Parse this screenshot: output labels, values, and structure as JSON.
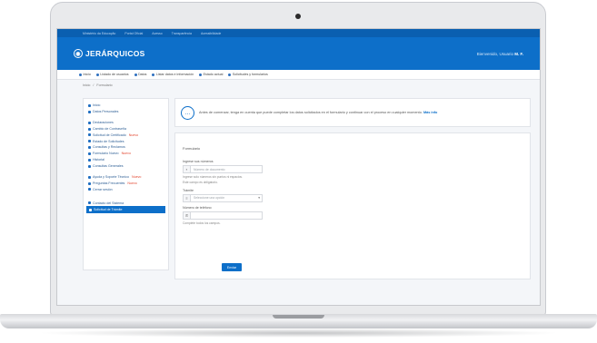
{
  "topstrip": {
    "items": [
      "Ministério da Educação",
      "Portal Oficial",
      "Acesso",
      "Transparência",
      "Acessibilidade"
    ]
  },
  "header": {
    "logo_text": "JERÁRQUICOS",
    "user_text": "Bienvenido, Usuario",
    "user_name": "M. F."
  },
  "menubar": {
    "items": [
      "Inicio",
      "Listado de usuarios",
      "Datos",
      "Listar datos e información",
      "Estado actual",
      "Solicitudes y formularios"
    ]
  },
  "breadcrumb": [
    "Inicio",
    "Formulario"
  ],
  "sidebar": {
    "group1": [
      "Inicio",
      "Datos Personales"
    ],
    "group2": [
      {
        "label": "Declaraciones",
        "badge": ""
      },
      {
        "label": "Cambio de Contraseña",
        "badge": ""
      },
      {
        "label": "Solicitud de Certificado",
        "badge": "Nuevo"
      },
      {
        "label": "Estado de Solicitudes",
        "badge": ""
      },
      {
        "label": "Consultas y Reclamos",
        "badge": ""
      },
      {
        "label": "Formulario Nuevo",
        "badge": "Nuevo"
      },
      {
        "label": "Historial",
        "badge": ""
      },
      {
        "label": "Consultas Generales",
        "badge": ""
      }
    ],
    "group3": [
      {
        "label": "Ayuda y Soporte Técnico",
        "badge": "Nuevo"
      },
      {
        "label": "Preguntas Frecuentes",
        "badge": "Nuevo"
      },
      {
        "label": "Cerrar sesión",
        "badge": ""
      }
    ],
    "group4": [
      {
        "label": "Contacto del Sistema",
        "active": false
      },
      {
        "label": "Solicitud de Trámite",
        "active": true
      }
    ]
  },
  "notice": {
    "text": "Antes de comenzar, tenga en cuenta que puede completar los datos solicitados en el formulario y continuar con el proceso en cualquier momento.",
    "link": "Más info"
  },
  "form": {
    "title": "Formulario",
    "field1_label": "Ingrese sus números",
    "field1_placeholder": "Número de documento",
    "hint1": "Ingrese solo números sin puntos ni espacios.",
    "hint2": "Este campo es obligatorio.",
    "field2_label": "Trámite",
    "field2_value": "Seleccione una opción",
    "field3_label": "Número de teléfono",
    "field3_value": "",
    "hint3": "Complete todos los campos.",
    "submit_label": "Enviar"
  },
  "colors": {
    "primary": "#0d6fc9",
    "badge": "#e2462f"
  }
}
